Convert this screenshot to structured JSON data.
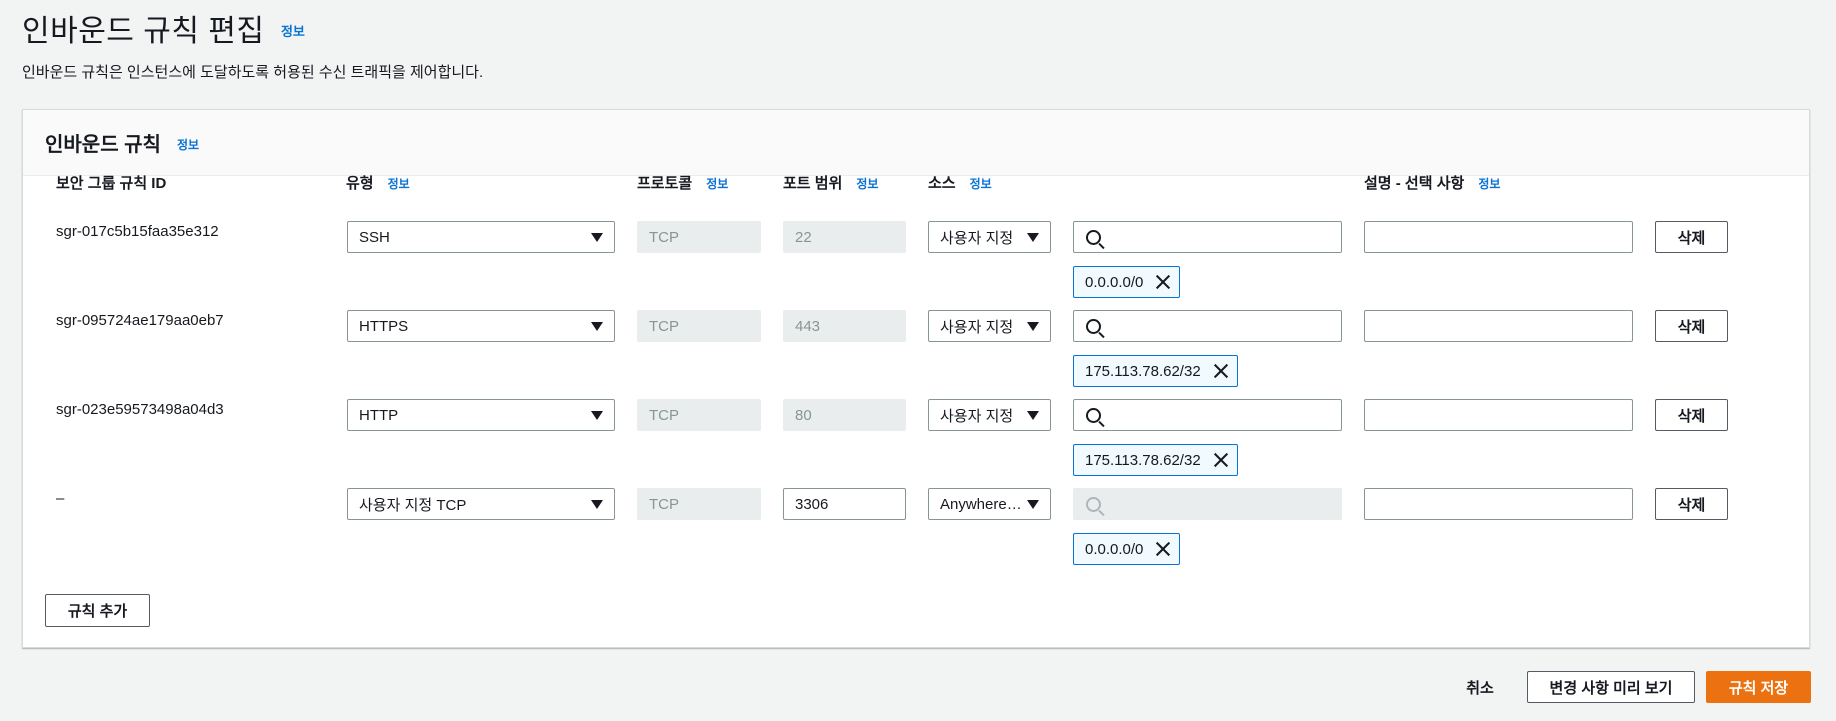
{
  "page": {
    "title": "인바운드 규칙 편집",
    "info": "정보",
    "description": "인바운드 규칙은 인스턴스에 도달하도록 허용된 수신 트래픽을 제어합니다."
  },
  "panel": {
    "title": "인바운드 규칙",
    "info": "정보",
    "columns": {
      "rule_id": "보안 그룹 규칙 ID",
      "type": "유형",
      "protocol": "프로토콜",
      "port_range": "포트 범위",
      "source": "소스",
      "description": "설명 - 선택 사항"
    },
    "rules": [
      {
        "id": "sgr-017c5b15faa35e312",
        "type": "SSH",
        "protocol": "TCP",
        "port": "22",
        "source_type": "사용자 지정",
        "source_search": "",
        "cidr": "0.0.0.0/0",
        "description": "",
        "delete": "삭제"
      },
      {
        "id": "sgr-095724ae179aa0eb7",
        "type": "HTTPS",
        "protocol": "TCP",
        "port": "443",
        "source_type": "사용자 지정",
        "source_search": "",
        "cidr": "175.113.78.62/32",
        "description": "",
        "delete": "삭제"
      },
      {
        "id": "sgr-023e59573498a04d3",
        "type": "HTTP",
        "protocol": "TCP",
        "port": "80",
        "source_type": "사용자 지정",
        "source_search": "",
        "cidr": "175.113.78.62/32",
        "description": "",
        "delete": "삭제"
      },
      {
        "id": "–",
        "type": "사용자 지정 TCP",
        "protocol": "TCP",
        "port": "3306",
        "source_type": "Anywhere…",
        "source_search": "",
        "cidr": "0.0.0.0/0",
        "description": "",
        "delete": "삭제"
      }
    ],
    "add_rule": "규칙 추가"
  },
  "footer": {
    "cancel": "취소",
    "preview": "변경 사항 미리 보기",
    "save": "규칙 저장"
  },
  "colors": {
    "primary": "#ec7211",
    "link": "#0972d3",
    "token_border": "#0972d3"
  }
}
